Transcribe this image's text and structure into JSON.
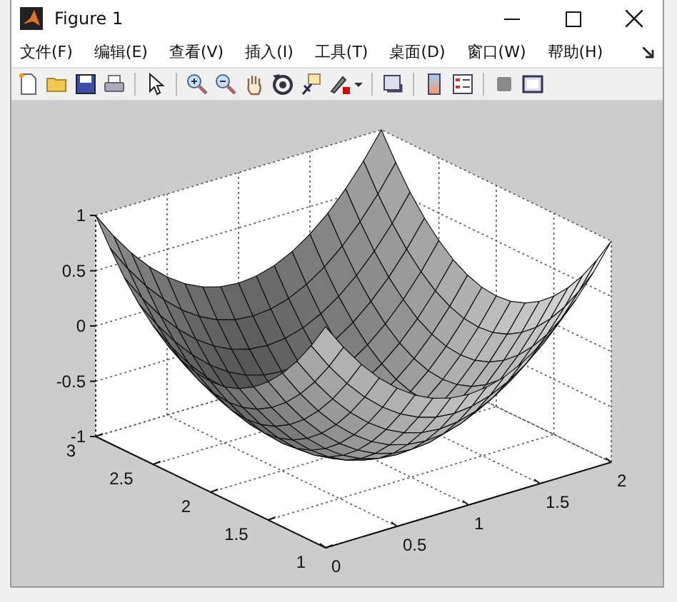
{
  "window": {
    "title": "Figure 1"
  },
  "menu": [
    {
      "label": "文件(F)"
    },
    {
      "label": "编辑(E)"
    },
    {
      "label": "查看(V)"
    },
    {
      "label": "插入(I)"
    },
    {
      "label": "工具(T)"
    },
    {
      "label": "桌面(D)"
    },
    {
      "label": "窗口(W)"
    },
    {
      "label": "帮助(H)"
    }
  ],
  "plot": {
    "x_ticks": [
      "0",
      "0.5",
      "1",
      "1.5",
      "2"
    ],
    "y_ticks": [
      "1",
      "1.5",
      "2",
      "2.5",
      "3"
    ],
    "z_ticks": [
      "1",
      "0.5",
      "0",
      "-0.5",
      "-1"
    ]
  }
}
